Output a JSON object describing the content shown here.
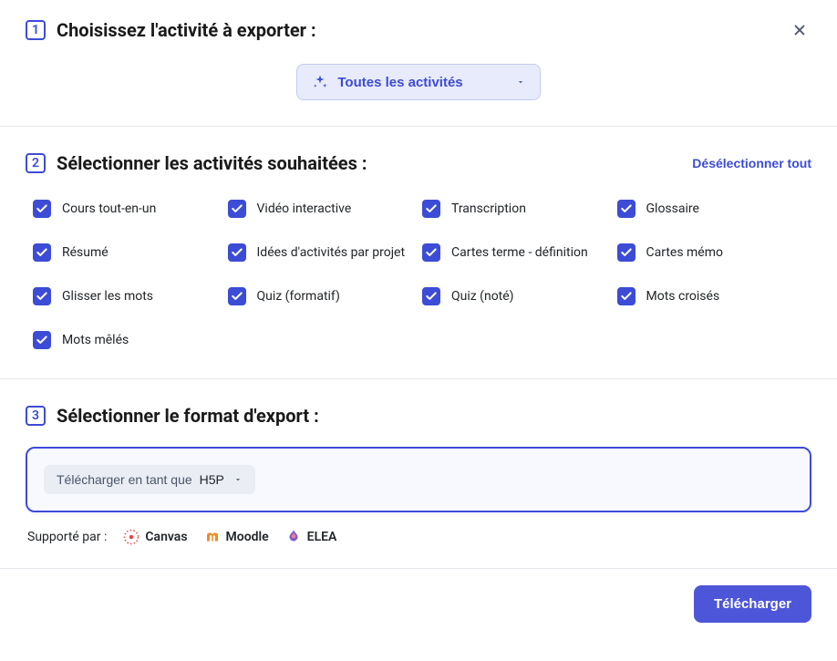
{
  "step1": {
    "number": "1",
    "title": "Choisissez l'activité à exporter :",
    "dropdown_label": "Toutes les activités"
  },
  "step2": {
    "number": "2",
    "title": "Sélectionner les activités souhaitées :",
    "deselect_label": "Désélectionner tout",
    "activities": [
      "Cours tout-en-un",
      "Vidéo interactive",
      "Transcription",
      "Glossaire",
      "Résumé",
      "Idées d'activités par projet",
      "Cartes terme - définition",
      "Cartes mémo",
      "Glisser les mots",
      "Quiz (formatif)",
      "Quiz (noté)",
      "Mots croisés",
      "Mots mêlés"
    ]
  },
  "step3": {
    "number": "3",
    "title": "Sélectionner le format d'export :",
    "format_prefix": "Télécharger en tant que",
    "format_value": "H5P",
    "supported_label": "Supporté par :",
    "platforms": [
      "Canvas",
      "Moodle",
      "ELEA"
    ]
  },
  "footer": {
    "download_label": "Télécharger"
  }
}
